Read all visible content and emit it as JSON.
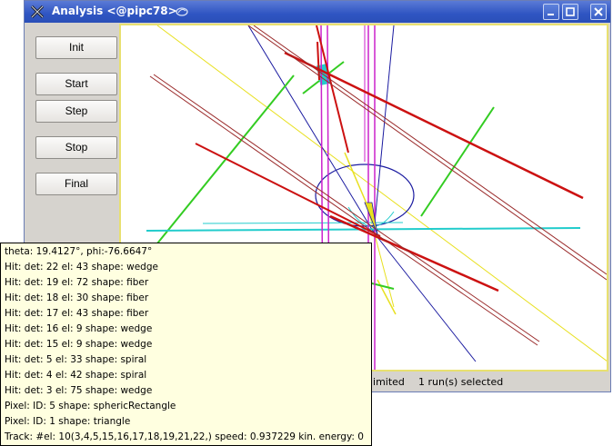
{
  "window": {
    "title": "Analysis <@pipc78>",
    "app_icon": "x-logo-icon",
    "deco_icon": "swirl-icon"
  },
  "controls": {
    "buttons": [
      {
        "id": "init",
        "label": "Init"
      },
      {
        "id": "start",
        "label": "Start"
      },
      {
        "id": "step",
        "label": "Step"
      },
      {
        "id": "stop",
        "label": "Stop"
      },
      {
        "id": "final",
        "label": "Final"
      }
    ]
  },
  "status": {
    "limit": "nlimited",
    "runs": "1 run(s) selected"
  },
  "tooltip": {
    "lines": [
      "theta: 19.4127°, phi:-76.6647°",
      "Hit: det: 22 el: 43 shape: wedge",
      "Hit: det: 19 el: 72 shape: fiber",
      "Hit: det: 18 el: 30 shape: fiber",
      "Hit: det: 17 el: 43 shape: fiber",
      "Hit: det: 16 el: 9 shape: wedge",
      "Hit: det: 15 el: 9 shape: wedge",
      "Hit: det: 5 el: 33 shape: spiral",
      "Hit: det: 4 el: 42 shape: spiral",
      "Hit: det: 3 el: 75 shape: wedge",
      "Pixel: ID: 5 shape: sphericRectangle",
      "Pixel: ID: 1 shape: triangle",
      "Track: #el: 10(3,4,5,15,16,17,18,19,21,22,) speed: 0.937229 kin. energy: 0"
    ]
  },
  "colors": {
    "titlebar": "#2f55c2",
    "canvas_border": "#e8e070",
    "tooltip_bg": "#ffffe0",
    "track_red": "#cc1111",
    "track_dark_red": "#9a2a2a",
    "detector_magenta": "#cc22cc",
    "detector_green": "#33cc22",
    "detector_yellow": "#e8e020",
    "detector_blue": "#1a1aa0",
    "detector_cyan": "#22cccc"
  }
}
